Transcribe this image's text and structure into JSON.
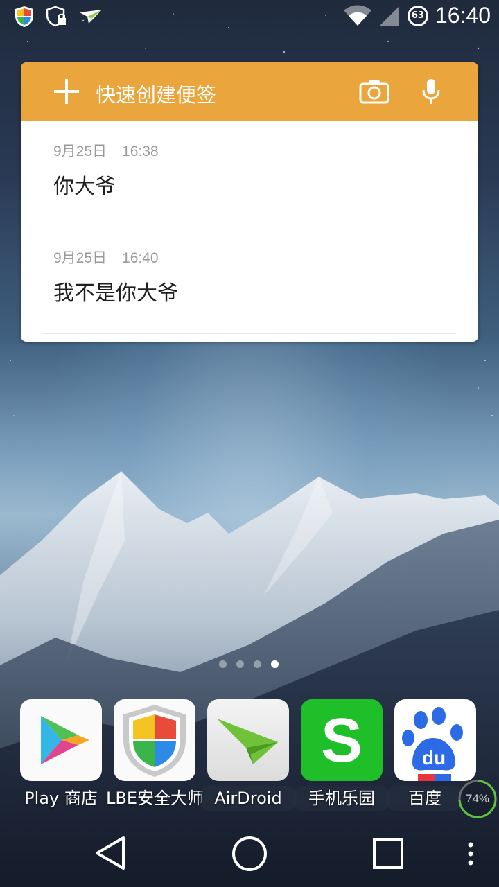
{
  "status_bar": {
    "time": "16:40",
    "notification_badge": "63",
    "icons": [
      "lbe-shield-icon",
      "security-lock-icon",
      "airdroid-icon",
      "wifi-icon",
      "signal-icon"
    ]
  },
  "widget": {
    "header": {
      "title": "快速创建便签",
      "icons": [
        "plus-icon",
        "camera-icon",
        "mic-icon"
      ],
      "color": "#eaa63c"
    },
    "notes": [
      {
        "date": "9月25日",
        "time": "16:38",
        "content": "你大爷"
      },
      {
        "date": "9月25日",
        "time": "16:40",
        "content": "我不是你大爷"
      }
    ]
  },
  "page_indicator": {
    "count": 4,
    "active_index": 3
  },
  "dock": {
    "apps": [
      {
        "label": "Play 商店",
        "icon": "play-store-icon"
      },
      {
        "label": "LBE安全大师",
        "icon": "lbe-shield-icon"
      },
      {
        "label": "AirDroid",
        "icon": "airdroid-icon"
      },
      {
        "label": "手机乐园",
        "icon": "s-app-icon"
      },
      {
        "label": "百度",
        "icon": "baidu-paw-icon"
      }
    ]
  },
  "battery_widget": {
    "percent": "74%",
    "level": 0.74
  },
  "nav_bar": {
    "buttons": [
      "back-icon",
      "home-icon",
      "recents-icon",
      "menu-icon"
    ]
  }
}
